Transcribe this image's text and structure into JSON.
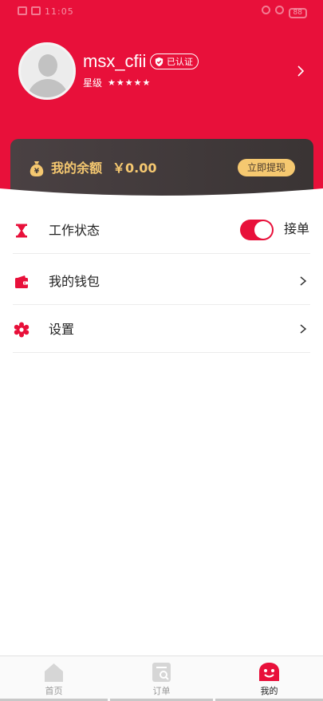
{
  "status_bar": {
    "left_text": "11:05",
    "battery": "88"
  },
  "profile": {
    "username": "msx_cfii",
    "verified_label": "已认证",
    "rating_label": "星级",
    "stars": "★★★★★"
  },
  "balance": {
    "label": "我的余额",
    "value": "￥0.00",
    "withdraw_label": "立即提现"
  },
  "menu": {
    "work_status": {
      "label": "工作状态",
      "toggle_label": "接单",
      "toggle_on": true
    },
    "wallet": {
      "label": "我的钱包"
    },
    "settings": {
      "label": "设置"
    }
  },
  "bottom_nav": {
    "items": [
      {
        "label": "首页",
        "icon": "home-icon"
      },
      {
        "label": "订单",
        "icon": "order-icon"
      },
      {
        "label": "我的",
        "icon": "profile-icon"
      }
    ],
    "active": "我的"
  },
  "colors": {
    "brand_red": "#e8103a",
    "gold": "#f5c870",
    "card_dark": "#413a3b"
  }
}
